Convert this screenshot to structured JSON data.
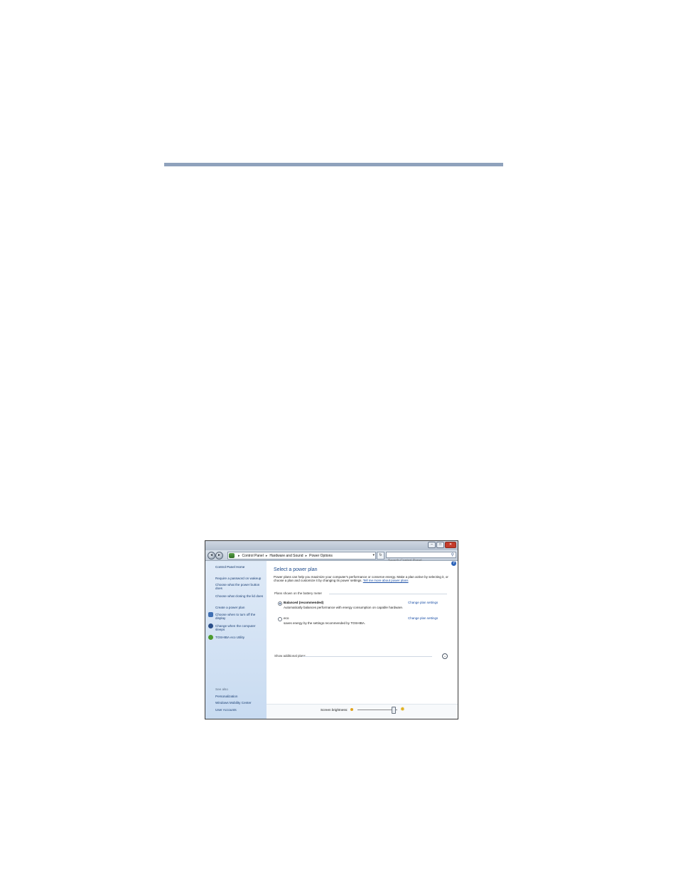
{
  "window": {
    "controls": [
      "–",
      "□",
      "✕"
    ]
  },
  "nav": {
    "back_icon": "◄",
    "forward_icon": "►",
    "breadcrumbs": [
      "Control Panel",
      "Hardware and Sound",
      "Power Options"
    ],
    "separator": "▸",
    "dropdown_icon": "▾",
    "refresh_icon": "↻",
    "search_placeholder": "Search Control Panel",
    "search_icon": "⚲"
  },
  "sidebar": {
    "home": "Control Panel Home",
    "links": [
      "Require a password on wakeup",
      "Choose what the power button does",
      "Choose what closing the lid does",
      "Create a power plan",
      "Choose when to turn off the display",
      "Change when the computer sleeps",
      "TOSHIBA eco Utility"
    ],
    "see_also": "See also",
    "see_also_links": [
      "Personalization",
      "Windows Mobility Center",
      "User Accounts"
    ]
  },
  "main": {
    "help_icon": "?",
    "title": "Select a power plan",
    "intro": "Power plans can help you maximize your computer's performance or conserve energy. Make a plan active by selecting it, or choose a plan and customize it by changing its power settings.",
    "intro_link": "Tell me more about power plans",
    "group_label": "Plans shown on the battery meter",
    "plans": [
      {
        "name": "Balanced (recommended)",
        "description": "Automatically balances performance with energy consumption on capable hardware.",
        "selected": true,
        "link": "Change plan settings"
      },
      {
        "name": "eco",
        "description": "saves energy by the settings recommended by TOSHIBA.",
        "selected": false,
        "link": "Change plan settings"
      }
    ],
    "show_more": "Show additional plans",
    "expand_icon": "⌄"
  },
  "bottom": {
    "brightness_label": "Screen brightness:",
    "brightness_level": 0.95,
    "bright_icon": "✹"
  }
}
